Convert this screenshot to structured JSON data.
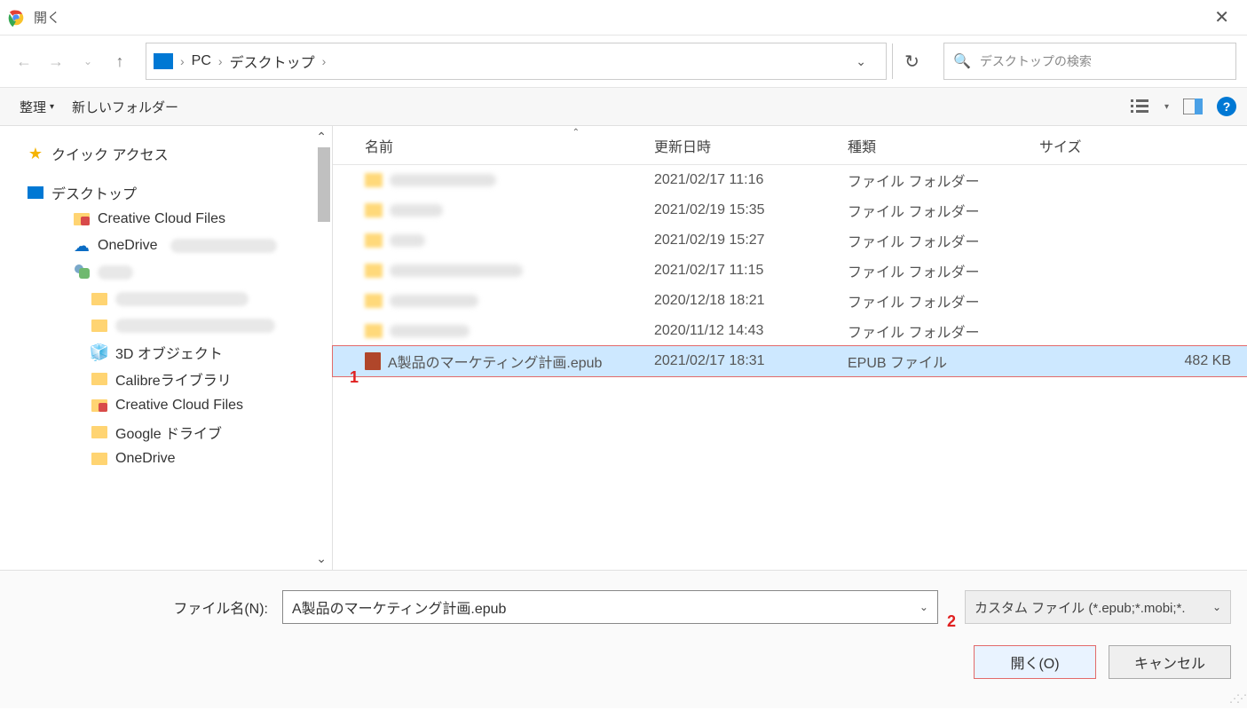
{
  "window": {
    "title": "開く"
  },
  "breadcrumb": {
    "root": "PC",
    "folder": "デスクトップ"
  },
  "search": {
    "placeholder": "デスクトップの検索"
  },
  "toolbar": {
    "organize": "整理",
    "new_folder": "新しいフォルダー"
  },
  "columns": {
    "name": "名前",
    "date": "更新日時",
    "kind": "種類",
    "size": "サイズ"
  },
  "sidebar": {
    "quick_access": "クイック アクセス",
    "desktop": "デスクトップ",
    "creative_cloud": "Creative Cloud Files",
    "onedrive": "OneDrive",
    "objects3d": "3D オブジェクト",
    "calibre": "Calibreライブラリ",
    "creative_cloud2": "Creative Cloud Files",
    "gdrive": "Google ドライブ",
    "onedrive2": "OneDrive"
  },
  "files": [
    {
      "name": "",
      "date": "2021/02/17 11:16",
      "kind": "ファイル フォルダー",
      "size": "",
      "icon": "folder",
      "blur": true
    },
    {
      "name": "",
      "date": "2021/02/19 15:35",
      "kind": "ファイル フォルダー",
      "size": "",
      "icon": "folder",
      "blur": true
    },
    {
      "name": "",
      "date": "2021/02/19 15:27",
      "kind": "ファイル フォルダー",
      "size": "",
      "icon": "folder",
      "blur": true
    },
    {
      "name": "",
      "date": "2021/02/17 11:15",
      "kind": "ファイル フォルダー",
      "size": "",
      "icon": "folder",
      "blur": true
    },
    {
      "name": "",
      "date": "2020/12/18 18:21",
      "kind": "ファイル フォルダー",
      "size": "",
      "icon": "folder",
      "blur": true
    },
    {
      "name": "",
      "date": "2020/11/12 14:43",
      "kind": "ファイル フォルダー",
      "size": "",
      "icon": "folder",
      "blur": true
    },
    {
      "name": "A製品のマーケティング計画.epub",
      "date": "2021/02/17 18:31",
      "kind": "EPUB ファイル",
      "size": "482 KB",
      "icon": "epub",
      "blur": false,
      "selected": true
    }
  ],
  "annotations": {
    "one": "1",
    "two": "2"
  },
  "footer": {
    "filename_label": "ファイル名(N):",
    "filename_value": "A製品のマーケティング計画.epub",
    "filetype_value": "カスタム ファイル (*.epub;*.mobi;*.",
    "open_btn": "開く(O)",
    "cancel_btn": "キャンセル"
  }
}
